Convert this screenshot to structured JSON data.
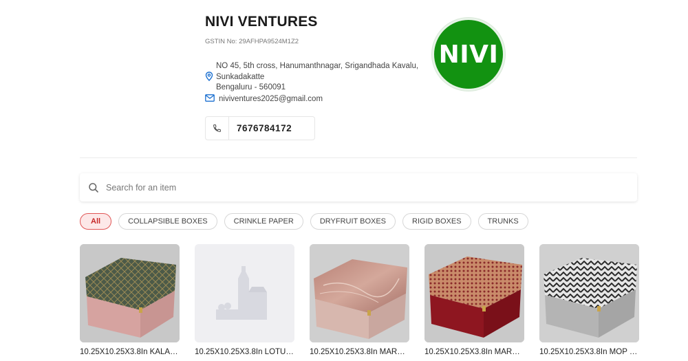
{
  "business": {
    "name": "NIVI VENTURES",
    "gstin": "GSTIN No: 29AFHPA9524M1Z2",
    "address_line1": "NO 45, 5th cross, Hanumanthnagar, Srigandhada Kavalu,",
    "address_line2": "Sunkadakatte",
    "address_line3": "Bengaluru - 560091",
    "email": "niviventures2025@gmail.com",
    "phone": "7676784172",
    "logo_text": "NIVI",
    "logo_color": "#129211"
  },
  "search": {
    "placeholder": "Search for an item",
    "icon": "search-icon"
  },
  "categories": {
    "all": "All",
    "c1": "COLLAPSIBLE BOXES",
    "c2": "CRINKLE PAPER",
    "c3": "DRYFRUIT BOXES",
    "c4": "RIGID BOXES",
    "c5": "TRUNKS",
    "active": "All",
    "active_color": "#e05555"
  },
  "products": [
    {
      "title": "10.25X10.25X3.8In KALA…"
    },
    {
      "title": "10.25X10.25X3.8In LOTU…"
    },
    {
      "title": "10.25X10.25X3.8In MARB…"
    },
    {
      "title": "10.25X10.25X3.8In MARO…"
    },
    {
      "title": "10.25X10.25X3.8In MOP …"
    }
  ]
}
